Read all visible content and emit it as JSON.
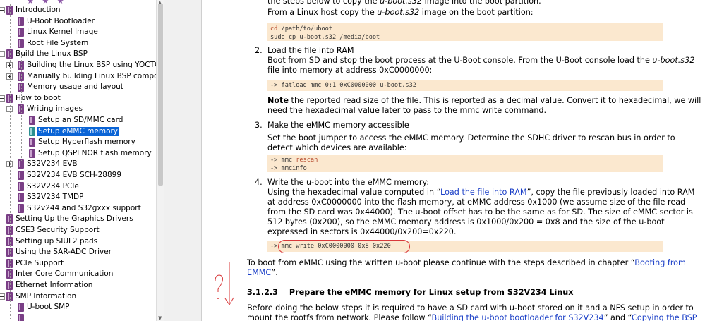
{
  "tree": {
    "stars": "★ ★ ★",
    "items": [
      {
        "label": "Introduction"
      },
      {
        "label": "U-Boot Bootloader"
      },
      {
        "label": "Linux Kernel Image"
      },
      {
        "label": "Root File System"
      },
      {
        "label": "Build the Linux BSP"
      },
      {
        "label": "Building the Linux BSP using YOCTO"
      },
      {
        "label": "Manually building Linux BSP componer"
      },
      {
        "label": "Memory usage and layout"
      },
      {
        "label": "How to boot"
      },
      {
        "label": "Writing images"
      },
      {
        "label": "Setup an SD/MMC card"
      },
      {
        "label": "Setup eMMC memory",
        "selected": true
      },
      {
        "label": "Setup Hyperflash memory"
      },
      {
        "label": "Setup QSPI NOR flash memory"
      },
      {
        "label": "S32V234 EVB"
      },
      {
        "label": "S32V234 EVB SCH-28899"
      },
      {
        "label": "S32V234 PCIe"
      },
      {
        "label": "S32V234 TMDP"
      },
      {
        "label": "S32v244 and S32gxxx support"
      },
      {
        "label": "Setting Up the Graphics Drivers"
      },
      {
        "label": "CSE3 Security Support"
      },
      {
        "label": "Setting up SIUL2 pads"
      },
      {
        "label": "Using the SAR-ADC Driver"
      },
      {
        "label": "PCIe Support"
      },
      {
        "label": "Inter Core Communication"
      },
      {
        "label": "Ethernet Information"
      },
      {
        "label": "SMP Information"
      },
      {
        "label": "U-boot SMP"
      },
      {
        "label": ""
      }
    ]
  },
  "doc": {
    "line0_a": "the steps below to copy the ",
    "line0_i": "u-boot.s32",
    "line0_b": " image into the boot partition.",
    "line1_a": "From a Linux host copy the ",
    "line1_i": "u-boot.s32",
    "line1_b": " image on the boot partition:",
    "code1_a": "cd",
    "code1_b": " /path/to/uboot",
    "code1_line2": "sudo cp u-boot.s32 /media/boot",
    "step2_num": "2.",
    "step2_title": "Load the file into RAM",
    "step2_l1_a": "Boot from SD and stop the boot process at the U-Boot console. From the U-Boot console load the ",
    "step2_l1_i": "u-boot.s32",
    "step2_l2": "file into memory at address 0xC0000000:",
    "code2": "-> fatload mmc 0:1 0xC0000000 u-boot.s32",
    "note_bold": "Note",
    "note_l1": " the reported read size of the file. This is reported as a decimal value. Convert it to hexadecimal, we will",
    "note_l2": "need the hexadecimal value later to pass to the mmc write command.",
    "step3_num": "3.",
    "step3_title": "Make the eMMC memory accessible",
    "step3_l1": "Set the boot jumper to access the eMMC memory. Determine the SDHC driver to rescan bus in order to",
    "step3_l2": "detect which devices are available:",
    "code3_a": "-> mmc ",
    "code3_kw": "rescan",
    "code3_line2": "-> mmcinfo",
    "step4_num": "4.",
    "step4_title": "Write the u-boot into the eMMC memory:",
    "step4_l1_a": "Using the hexadecimal value computed in “",
    "step4_l1_link": "Load the file into RAM",
    "step4_l1_b": "”, copy the file previously loaded into RAM",
    "step4_l2": "at address 0xC0000000 into the flash memory, at eMMC address 0x1000 (we assume size of the file read",
    "step4_l3": "from the SD card was 0x44000). The u-boot offset has to be the same as for SD. The size of eMMC sector is",
    "step4_l4": "512 bytes (0x200), so the eMMC memory address is 0x1000/0x200 = 0x8 and the size of the u-boot",
    "step4_l5": "expressed in sectors is 0x44000/0x200=0x220.",
    "code4": "-> mmc write 0xC0000000 0x8 0x220",
    "after_l1_a": "To boot from eMMC using the written u-boot please continue with the steps described in chapter “",
    "after_l1_link": "Booting from",
    "after_l2_link": "EMMC",
    "after_l2_b": "”.",
    "h_num": "3.1.2.3",
    "h_title": "Prepare the eMMC memory for Linux setup from S32V234 Linux",
    "last_l1": "Before doing the below steps it is required to have a SD card with u-boot stored on it and a NFS setup in order to",
    "last_l2_a": "mount the rootfs from network. Please follow “",
    "last_l2_link1": "Building the u-boot bootloader for S32V234",
    "last_l2_b": "” and “",
    "last_l2_link2": "Copying the BSP"
  }
}
